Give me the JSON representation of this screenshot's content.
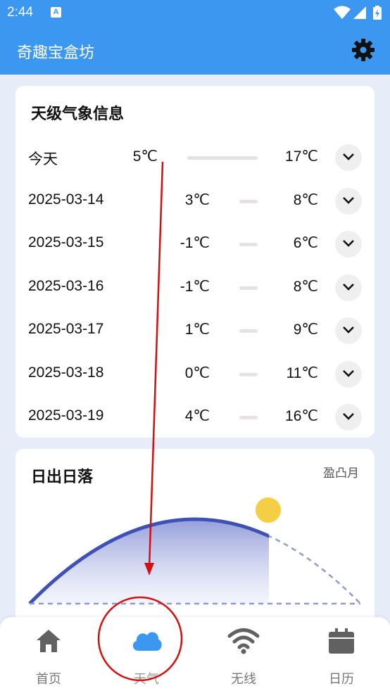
{
  "status_bar": {
    "time": "2:44",
    "notification_icon": "A"
  },
  "app_bar": {
    "title": "奇趣宝盒坊",
    "settings_icon": "gear-icon"
  },
  "forecast": {
    "title": "天级气象信息",
    "days": [
      {
        "date": "今天",
        "low": "5℃",
        "high": "17℃"
      },
      {
        "date": "2025-03-14",
        "low": "3℃",
        "high": "8℃"
      },
      {
        "date": "2025-03-15",
        "low": "-1℃",
        "high": "6℃"
      },
      {
        "date": "2025-03-16",
        "low": "-1℃",
        "high": "8℃"
      },
      {
        "date": "2025-03-17",
        "low": "1℃",
        "high": "9℃"
      },
      {
        "date": "2025-03-18",
        "low": "0℃",
        "high": "11℃"
      },
      {
        "date": "2025-03-19",
        "low": "4℃",
        "high": "16℃"
      }
    ]
  },
  "sun": {
    "title": "日出日落",
    "moon_phase": "盈凸月",
    "arc_color": "#3f51b5",
    "sun_color": "#f4cf46"
  },
  "bottom_nav": {
    "items": [
      {
        "label": "首页",
        "icon": "home-icon"
      },
      {
        "label": "天气",
        "icon": "cloud-icon"
      },
      {
        "label": "无线",
        "icon": "wifi-icon"
      },
      {
        "label": "日历",
        "icon": "calendar-icon"
      }
    ],
    "active_index": 1
  },
  "colors": {
    "primary": "#3c97f0",
    "background": "#e7edf8",
    "annotation": "#d40f0f"
  }
}
